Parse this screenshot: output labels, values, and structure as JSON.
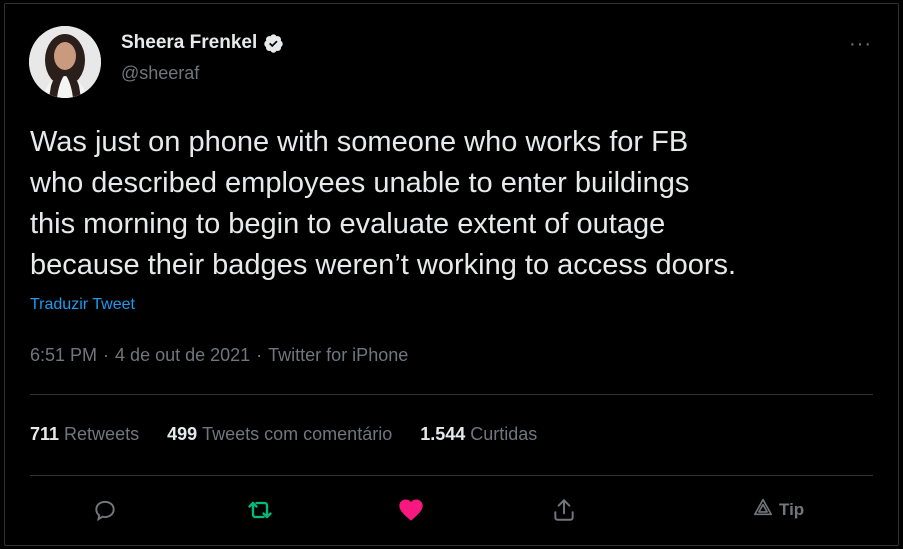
{
  "author": {
    "name": "Sheera Frenkel",
    "handle": "@sheeraf"
  },
  "tweet": {
    "text": "Was just on phone with someone who works for FB\nwho described employees unable to enter buildings\nthis morning to begin to evaluate extent of outage\nbecause their badges weren’t working to access doors.",
    "translate_label": "Traduzir Tweet",
    "time": "6:51 PM",
    "date": "4 de out de 2021",
    "source": "Twitter for iPhone",
    "separator": "·"
  },
  "stats": [
    {
      "count": "711",
      "label": "Retweets"
    },
    {
      "count": "499",
      "label": "Tweets com comentário"
    },
    {
      "count": "1.544",
      "label": "Curtidas"
    }
  ],
  "actions": {
    "tip_label": "Tip"
  },
  "colors": {
    "background": "#000000",
    "text": "#e7e9ea",
    "muted": "#71767b",
    "link": "#1d9bf0",
    "retweet": "#00ba7c",
    "like": "#f91880",
    "border": "#2f3336"
  },
  "icons": [
    "verified-badge-icon",
    "more-icon",
    "reply-icon",
    "retweet-icon",
    "like-icon",
    "share-icon",
    "tip-icon"
  ]
}
